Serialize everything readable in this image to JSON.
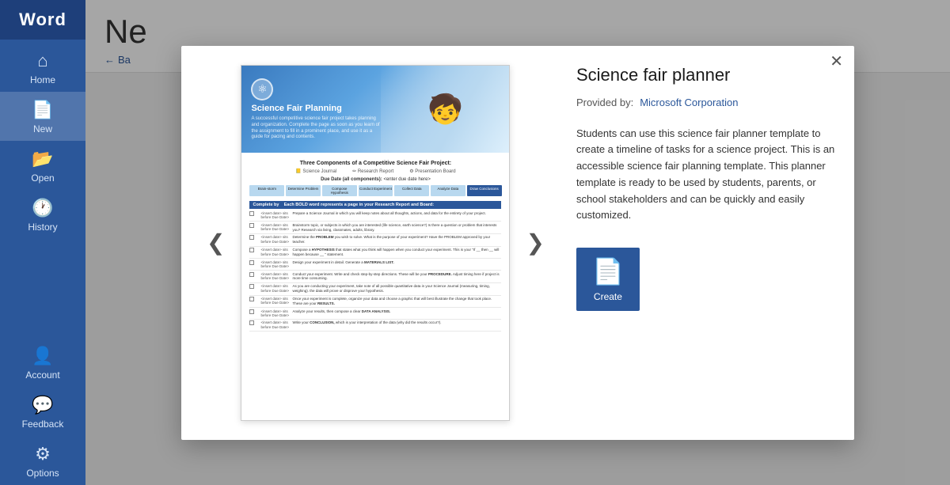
{
  "sidebar": {
    "logo": "Word",
    "items": [
      {
        "id": "home",
        "label": "Home",
        "icon": "⌂"
      },
      {
        "id": "new",
        "label": "New",
        "icon": "📄"
      },
      {
        "id": "open",
        "label": "Open",
        "icon": "📂"
      },
      {
        "id": "history",
        "label": "History",
        "icon": ""
      }
    ],
    "bottom_items": [
      {
        "id": "account",
        "label": "Account",
        "icon": "👤"
      },
      {
        "id": "feedback",
        "label": "Feedback",
        "icon": "💬"
      },
      {
        "id": "options",
        "label": "Options",
        "icon": "⚙"
      }
    ]
  },
  "main": {
    "title": "Ne",
    "back_label": "Ba"
  },
  "modal": {
    "close_label": "✕",
    "template": {
      "name": "Science fair planner",
      "provider_label": "Provided by:",
      "provider": "Microsoft Corporation",
      "description": "Students can use this science fair planner template to create a timeline of tasks for a science project. This is an accessible science fair planning template. This planner template is ready to be used by students, parents, or school stakeholders and can be quickly and easily customized.",
      "create_label": "Create"
    },
    "nav": {
      "prev": "❮",
      "next": "❯"
    },
    "preview": {
      "header_title": "Science Fair Planning",
      "header_subtitle": "A successful competitive science fair project takes planning and organization. Complete the page as soon as you learn of the assignment to fill in a prominent place, and use it as a guide for pacing and contents.",
      "section_title": "Three Components of a Competitive Science Fair Project:",
      "items": [
        "Science Journal",
        "Research Report",
        "Presentation Board"
      ],
      "due_label": "Due Date (all components):",
      "due_placeholder": "<enter due date here>",
      "timeline_steps": [
        "Brainstorm",
        "Determine Problem",
        "Compose Hypothesis",
        "Conduct Experiment",
        "Collect Data",
        "Analyze Data",
        "Draw Conclusions"
      ],
      "table_header": "Complete by   Each BOLD word represents a page in your Research Report and Board:",
      "rows": [
        {
          "date": "<insert date>",
          "bold_text": "SCIENCE JOURNAL"
        },
        {
          "date": "<insert date>",
          "bold_text": "Brainstorm"
        },
        {
          "date": "<insert date>",
          "bold_text": "PROBLEM"
        },
        {
          "date": "<insert date>",
          "bold_text": "HYPOTHESIS"
        },
        {
          "date": "<insert date>",
          "bold_text": "MATERIALS LIST"
        },
        {
          "date": "<insert date>",
          "bold_text": "PROCEDURE"
        },
        {
          "date": "<insert date>",
          "bold_text": "RESULTS"
        },
        {
          "date": "<insert date>",
          "bold_text": "DATA ANALYSIS"
        },
        {
          "date": "<insert date>",
          "bold_text": "CONCLUSION"
        }
      ]
    }
  }
}
